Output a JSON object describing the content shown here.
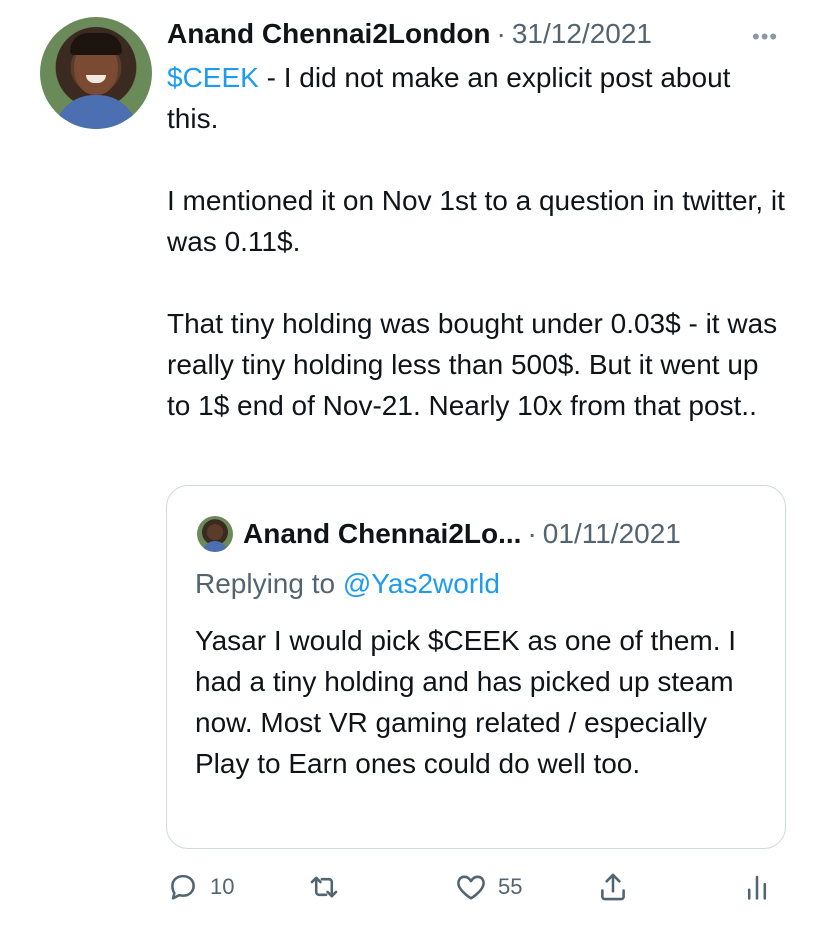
{
  "tweet": {
    "author_name": "Anand Chennai2London",
    "separator": "·",
    "date": "31/12/2021",
    "more_icon": "more-icon",
    "cashtag": "$CEEK",
    "line1_rest": " - I did not make an explicit post about this.",
    "para2": "I mentioned it on Nov 1st to a question in twitter, it was 0.11$.",
    "para3": "That tiny holding was bought under 0.03$ - it was really tiny holding less than 500$. But it went up to 1$ end of Nov-21. Nearly 10x from that post.."
  },
  "quote": {
    "author_name": "Anand Chennai2Lo...",
    "separator": "·",
    "date": "01/11/2021",
    "replying_prefix": "Replying to ",
    "replying_handle": "@Yas2world",
    "text": "Yasar I would pick $CEEK as one of them. I had a tiny holding and has picked up steam now. Most VR gaming related / especially Play to Earn ones could do well too."
  },
  "actions": {
    "reply_count": "10",
    "like_count": "55",
    "icons": [
      "reply-icon",
      "retweet-icon",
      "like-icon",
      "share-icon",
      "analytics-icon"
    ]
  },
  "colors": {
    "accent": "#1d9bf0",
    "secondary_text": "#536471",
    "border": "#cfd9de"
  }
}
